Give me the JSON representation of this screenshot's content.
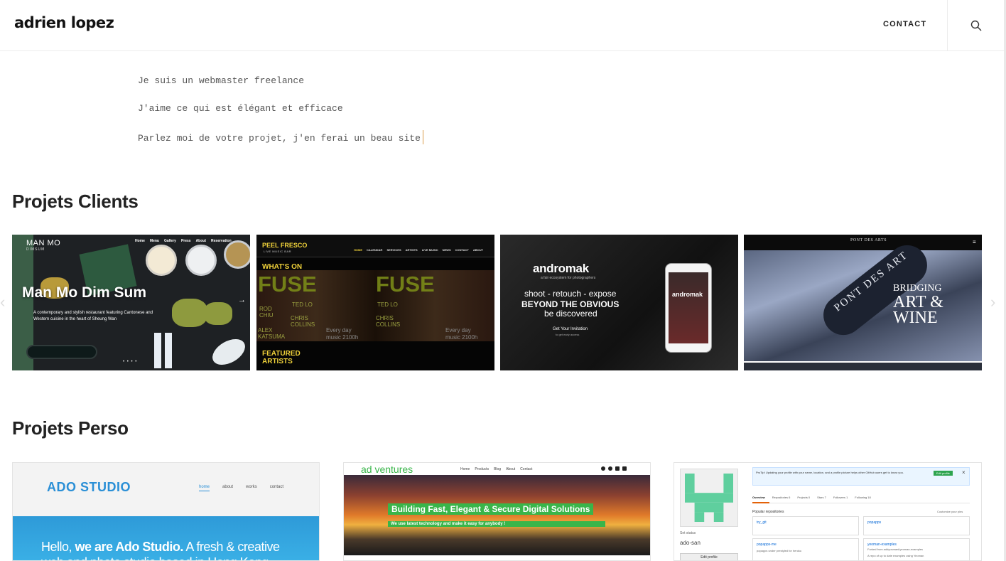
{
  "header": {
    "logo": "adrien lopez",
    "contact_label": "CONTACT",
    "search_icon": "search-icon"
  },
  "intro": {
    "lines": [
      "Je suis un webmaster freelance",
      "J'aime ce qui est élégant et efficace",
      "Parlez moi de votre projet, j'en ferai un beau site"
    ]
  },
  "clients": {
    "title": "Projets Clients",
    "prev_arrow": "‹",
    "next_arrow": "›",
    "cards": [
      {
        "name": "Man Mo Dim Sum",
        "tagline": "A contemporary and stylish restaurant featuring Cantonese and Western cuisine in the heart of Sheung Wan",
        "brand": "MAN MO",
        "sub_brand": "DIMSUM",
        "nav": [
          "Home",
          "Menu",
          "Gallery",
          "Press",
          "About",
          "Reservation"
        ],
        "next_glyph": "→",
        "dots": "• • • •"
      },
      {
        "brand": "PEEL FRESCO",
        "brand_sub": "LIVE MUSIC BAR",
        "nav": [
          "HOME",
          "CALENDAR",
          "SERVICES",
          "ARTISTS",
          "LIVE MUSIC",
          "NEWS",
          "CONTACT",
          "ABOUT"
        ],
        "whats_on": "WHAT'S ON",
        "fuse": "FUSE",
        "names_left": "ROD CHIU",
        "names_mid": "TED LO",
        "names_chris": "CHRIS COLLINS",
        "names_alex": "ALEX KATSUMA",
        "schedule": "Every day music 2100h",
        "featured": "FEATURED ARTISTS"
      },
      {
        "brand": "andromak",
        "sub": "a fair ecosystem for photographers",
        "line1": "shoot - retouch - expose",
        "line2": "BEYOND THE OBVIOUS",
        "line3": "be discovered",
        "cta": "Get Your Invitation",
        "cta_sub": "to get early access",
        "phone_brand": "andromak"
      },
      {
        "top_brand": "PONT DES ARTS",
        "bottle_text": "PONT DES ART",
        "headline_1": "BRIDGING",
        "headline_2": "ART &",
        "headline_3": "WINE",
        "menu_glyph": "≡"
      }
    ]
  },
  "perso": {
    "title": "Projets Perso",
    "cards": [
      {
        "brand": "ADO STUDIO",
        "nav": [
          "home",
          "about",
          "works",
          "contact"
        ],
        "hero_a": "Hello, ",
        "hero_b": "we are Ado Studio.",
        "hero_c": " A fresh & creative",
        "hero_d": "web and photo studio based in Hong Kong"
      },
      {
        "brand": "ad ventures",
        "nav": [
          "Home",
          "Products",
          "Blog",
          "About",
          "Contact"
        ],
        "headline": "Building Fast, Elegant & Secure Digital Solutions",
        "subline": "We use latest technology and make it easy for anybody !"
      },
      {
        "banner": "ProTip! Updating your profile with your name, location, and a profile picture helps other GitHub users get to know you.",
        "edit_btn": "Edit profile",
        "close_glyph": "×",
        "tabs": [
          "Overview",
          "Repositories 6",
          "Projects 0",
          "Stars 7",
          "Followers 1",
          "Following 18"
        ],
        "popular": "Popular repositories",
        "customize": "Customize your pins",
        "status": "Set status",
        "username": "ado-san",
        "edit_profile": "Edit profile",
        "repos": [
          {
            "name": "try_git",
            "desc": ""
          },
          {
            "name": "popapps",
            "desc": ""
          },
          {
            "name": "popapps-me",
            "desc": "popapps under prestyled for heroku"
          },
          {
            "name": "yeoman-examples",
            "desc": "Forked from addyosmani/yeoman-examples"
          }
        ],
        "repo_extra": "A repo of up to date examples using Yeoman"
      }
    ]
  },
  "colors": {
    "accent_blue": "#2a8fd6",
    "accent_green": "#39b54a",
    "cursor": "#d99a4a",
    "github_green": "#2ea44f",
    "identicon": "#5fcf9e"
  }
}
